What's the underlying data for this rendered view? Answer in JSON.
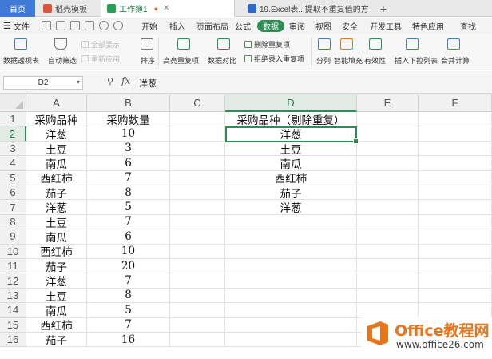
{
  "tabs": {
    "home": "首页",
    "t1": "稻壳模板",
    "t2": "工作簿1",
    "t3": "19.Excel表...提取不重复值的方法"
  },
  "menu": {
    "file": "文件",
    "items": [
      "开始",
      "插入",
      "页面布局",
      "公式",
      "数据",
      "审阅",
      "视图",
      "安全",
      "开发工具",
      "特色应用",
      "查找"
    ],
    "active_index": 4
  },
  "ribbon": {
    "pivot": "数据透视表",
    "autofilter": "自动筛选",
    "show_all": "全部显示",
    "reapply": "重新应用",
    "sort": "排序",
    "highlight_dup": "高亮重复项",
    "compare": "数据对比",
    "remove_dup": "删除重复项",
    "reject_dup": "拒绝录入重复项",
    "split": "分列",
    "smart_fill": "智能填充",
    "validity": "有效性",
    "dropdown": "插入下拉列表",
    "consolidate": "合并计算"
  },
  "formula_bar": {
    "name_box": "D2",
    "fx": "fx",
    "value": "洋葱"
  },
  "columns": [
    "A",
    "B",
    "C",
    "D",
    "E",
    "F"
  ],
  "rows": [
    "1",
    "2",
    "3",
    "4",
    "5",
    "6",
    "7",
    "8",
    "9",
    "10",
    "11",
    "12",
    "13",
    "14",
    "15",
    "16"
  ],
  "sheet": {
    "A": [
      "采购品种",
      "洋葱",
      "土豆",
      "南瓜",
      "西红柿",
      "茄子",
      "洋葱",
      "土豆",
      "南瓜",
      "西红柿",
      "茄子",
      "洋葱",
      "土豆",
      "南瓜",
      "西红柿",
      "茄子"
    ],
    "B": [
      "采购数量",
      "10",
      "3",
      "6",
      "7",
      "8",
      "5",
      "7",
      "6",
      "10",
      "20",
      "7",
      "8",
      "5",
      "7",
      "16"
    ],
    "D": [
      "采购品种（剔除重复）",
      "洋葱",
      "土豆",
      "南瓜",
      "西红柿",
      "茄子",
      "洋葱",
      "",
      "",
      "",
      "",
      "",
      "",
      "",
      "",
      ""
    ]
  },
  "watermark": {
    "title": "Office教程网",
    "url": "www.office26.com"
  },
  "colors": {
    "accent": "#2d8f57",
    "home_tab": "#3f7bd6",
    "watermark": "#e8751a"
  }
}
